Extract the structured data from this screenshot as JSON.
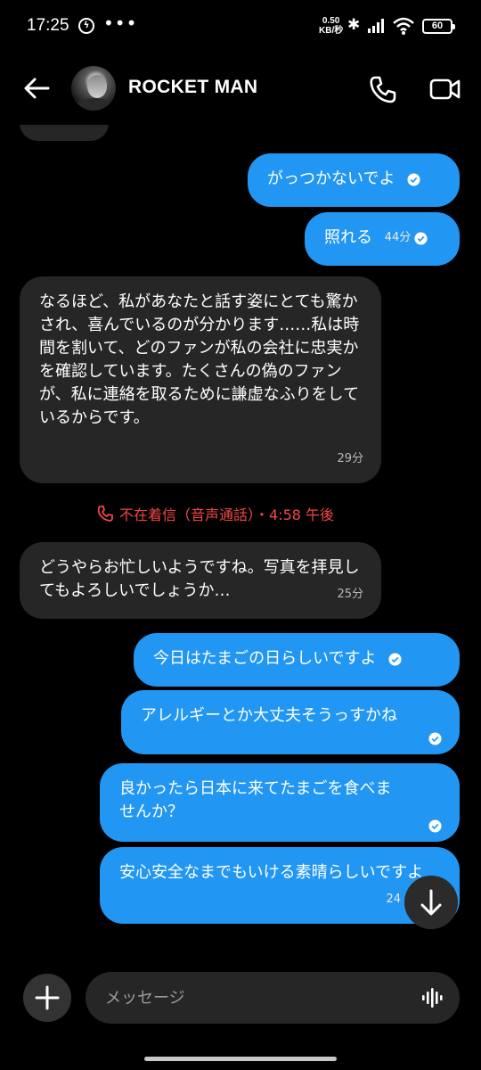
{
  "status_bar": {
    "time": "17:25",
    "dots": "•••",
    "net_speed_value": "0.50",
    "net_speed_unit": "KB/秒",
    "battery": "60",
    "icons": [
      "messenger-icon",
      "bluetooth-icon",
      "signal-icon",
      "wifi-icon",
      "battery-icon"
    ]
  },
  "header": {
    "contact_name": "ROCKET MAN",
    "icons": [
      "back-arrow-icon",
      "phone-icon",
      "video-camera-icon"
    ]
  },
  "messages": [
    {
      "side": "out",
      "text": "がっつかないでよ",
      "time": "",
      "read": true
    },
    {
      "side": "out",
      "text": "照れる",
      "time": "44分",
      "read": true
    },
    {
      "side": "in",
      "text": "なるほど、私があなたと話す姿にとても驚かされ、喜んでいるのが分かります……私は時間を割いて、どのファンが私の会社に忠実かを確認しています。たくさんの偽のファンが、私に連絡を取るために謙虚なふりをしているからです。",
      "time": "29分"
    },
    {
      "side": "in",
      "text": "どうやらお忙しいようですね。写真を拝見してもよろしいでしょうか…",
      "time": "25分"
    },
    {
      "side": "out",
      "text": "今日はたまごの日らしいですよ",
      "time": "",
      "read": true
    },
    {
      "side": "out",
      "text": "アレルギーとか大丈夫そうっすかね",
      "time": "",
      "read": true
    },
    {
      "side": "out",
      "text": "良かったら日本に来てたまごを食べませんか？",
      "time": "",
      "read": true
    },
    {
      "side": "out",
      "text": "安心安全なまでもいける素晴らしいですよ",
      "time": "24",
      "read": false
    }
  ],
  "missed_call": {
    "text": "不在着信（音声通話）・4:58 午後"
  },
  "composer": {
    "placeholder": "メッセージ"
  },
  "colors": {
    "background": "#000000",
    "outgoing_bubble": "#2196f3",
    "incoming_bubble": "#262626",
    "missed_call": "#f24646"
  }
}
